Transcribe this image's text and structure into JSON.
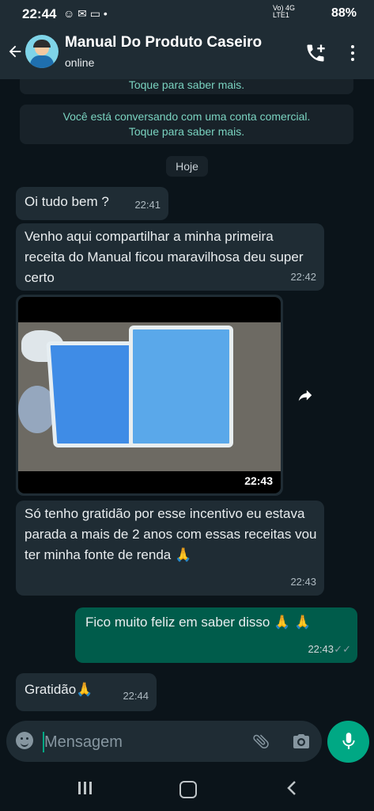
{
  "status_bar": {
    "time": "22:44",
    "notification_icons": "☺ ✉ ▭ •",
    "network_top": "Vo) 4G",
    "network_bottom": "LTE1",
    "battery": "88%"
  },
  "header": {
    "title": "Manual Do Produto Caseiro",
    "status": "online"
  },
  "system_messages": {
    "partial": "Toque para saber mais.",
    "business_line1": "Você está conversando com uma conta comercial.",
    "business_line2": "Toque para saber mais."
  },
  "date_chip": "Hoje",
  "messages": [
    {
      "direction": "in",
      "text": "Oi tudo bem ?",
      "time": "22:41"
    },
    {
      "direction": "in",
      "text": "Venho aqui compartilhar a minha primeira receita do Manual ficou maravilhosa deu super certo",
      "time": "22:42"
    },
    {
      "direction": "in",
      "type": "video",
      "time": "22:43"
    },
    {
      "direction": "in",
      "text": "Só tenho gratidão por esse incentivo eu estava parada a mais de 2 anos com essas receitas vou ter minha fonte de renda 🙏",
      "time": "22:43"
    },
    {
      "direction": "out",
      "text": "Fico muito feliz em saber disso 🙏 🙏",
      "time": "22:43",
      "tick": "✓✓"
    },
    {
      "direction": "in",
      "text": "Gratidão🙏",
      "time": "22:44"
    }
  ],
  "composer": {
    "placeholder": "Mensagem"
  },
  "colors": {
    "background": "#0b141a",
    "header": "#1f2c34",
    "incoming_bubble": "#1f2c34",
    "outgoing_bubble": "#005c4b",
    "accent": "#00a884",
    "system_text": "#7ad3c0"
  },
  "icons": [
    "back-arrow-icon",
    "add-call-icon",
    "more-options-icon",
    "share-icon",
    "emoji-icon",
    "attach-icon",
    "camera-icon",
    "mic-icon"
  ]
}
